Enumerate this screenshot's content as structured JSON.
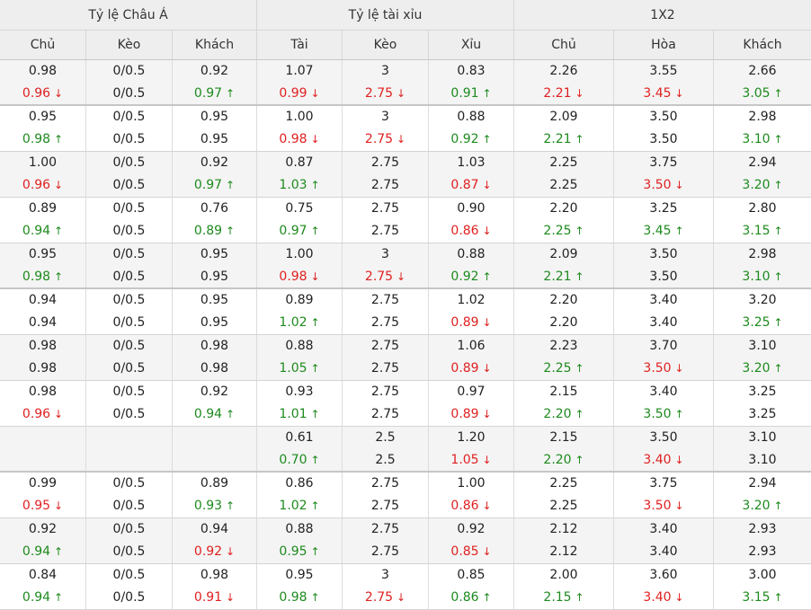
{
  "colors": {
    "up": "#1d8a1d",
    "down": "#e02020",
    "header_bg": "#eeeeee",
    "shade_bg": "#f4f4f4"
  },
  "header": {
    "groups": [
      "Tỷ lệ Châu Á",
      "Tỷ lệ tài xỉu",
      "1X2"
    ],
    "columns": [
      "Chủ",
      "Kèo",
      "Khách",
      "Tài",
      "Kèo",
      "Xỉu",
      "Chủ",
      "Hòa",
      "Khách"
    ]
  },
  "rows": [
    {
      "shade": true,
      "thick": true,
      "cells": [
        [
          [
            "0.98",
            ""
          ],
          [
            "0.96",
            "down"
          ]
        ],
        [
          [
            "0/0.5",
            ""
          ],
          [
            "0/0.5",
            ""
          ]
        ],
        [
          [
            "0.92",
            ""
          ],
          [
            "0.97",
            "up"
          ]
        ],
        [
          [
            "1.07",
            ""
          ],
          [
            "0.99",
            "down"
          ]
        ],
        [
          [
            "3",
            ""
          ],
          [
            "2.75",
            "down"
          ]
        ],
        [
          [
            "0.83",
            ""
          ],
          [
            "0.91",
            "up"
          ]
        ],
        [
          [
            "2.26",
            ""
          ],
          [
            "2.21",
            "down"
          ]
        ],
        [
          [
            "3.55",
            ""
          ],
          [
            "3.45",
            "down"
          ]
        ],
        [
          [
            "2.66",
            ""
          ],
          [
            "3.05",
            "up"
          ]
        ]
      ]
    },
    {
      "shade": false,
      "thick": false,
      "cells": [
        [
          [
            "0.95",
            ""
          ],
          [
            "0.98",
            "up"
          ]
        ],
        [
          [
            "0/0.5",
            ""
          ],
          [
            "0/0.5",
            ""
          ]
        ],
        [
          [
            "0.95",
            ""
          ],
          [
            "0.95",
            ""
          ]
        ],
        [
          [
            "1.00",
            ""
          ],
          [
            "0.98",
            "down"
          ]
        ],
        [
          [
            "3",
            ""
          ],
          [
            "2.75",
            "down"
          ]
        ],
        [
          [
            "0.88",
            ""
          ],
          [
            "0.92",
            "up"
          ]
        ],
        [
          [
            "2.09",
            ""
          ],
          [
            "2.21",
            "up"
          ]
        ],
        [
          [
            "3.50",
            ""
          ],
          [
            "3.50",
            ""
          ]
        ],
        [
          [
            "2.98",
            ""
          ],
          [
            "3.10",
            "up"
          ]
        ]
      ]
    },
    {
      "shade": true,
      "thick": false,
      "cells": [
        [
          [
            "1.00",
            ""
          ],
          [
            "0.96",
            "down"
          ]
        ],
        [
          [
            "0/0.5",
            ""
          ],
          [
            "0/0.5",
            ""
          ]
        ],
        [
          [
            "0.92",
            ""
          ],
          [
            "0.97",
            "up"
          ]
        ],
        [
          [
            "0.87",
            ""
          ],
          [
            "1.03",
            "up"
          ]
        ],
        [
          [
            "2.75",
            ""
          ],
          [
            "2.75",
            ""
          ]
        ],
        [
          [
            "1.03",
            ""
          ],
          [
            "0.87",
            "down"
          ]
        ],
        [
          [
            "2.25",
            ""
          ],
          [
            "2.25",
            ""
          ]
        ],
        [
          [
            "3.75",
            ""
          ],
          [
            "3.50",
            "down"
          ]
        ],
        [
          [
            "2.94",
            ""
          ],
          [
            "3.20",
            "up"
          ]
        ]
      ]
    },
    {
      "shade": false,
      "thick": false,
      "cells": [
        [
          [
            "0.89",
            ""
          ],
          [
            "0.94",
            "up"
          ]
        ],
        [
          [
            "0/0.5",
            ""
          ],
          [
            "0/0.5",
            ""
          ]
        ],
        [
          [
            "0.76",
            ""
          ],
          [
            "0.89",
            "up"
          ]
        ],
        [
          [
            "0.75",
            ""
          ],
          [
            "0.97",
            "up"
          ]
        ],
        [
          [
            "2.75",
            ""
          ],
          [
            "2.75",
            ""
          ]
        ],
        [
          [
            "0.90",
            ""
          ],
          [
            "0.86",
            "down"
          ]
        ],
        [
          [
            "2.20",
            ""
          ],
          [
            "2.25",
            "up"
          ]
        ],
        [
          [
            "3.25",
            ""
          ],
          [
            "3.45",
            "up"
          ]
        ],
        [
          [
            "2.80",
            ""
          ],
          [
            "3.15",
            "up"
          ]
        ]
      ]
    },
    {
      "shade": true,
      "thick": true,
      "cells": [
        [
          [
            "0.95",
            ""
          ],
          [
            "0.98",
            "up"
          ]
        ],
        [
          [
            "0/0.5",
            ""
          ],
          [
            "0/0.5",
            ""
          ]
        ],
        [
          [
            "0.95",
            ""
          ],
          [
            "0.95",
            ""
          ]
        ],
        [
          [
            "1.00",
            ""
          ],
          [
            "0.98",
            "down"
          ]
        ],
        [
          [
            "3",
            ""
          ],
          [
            "2.75",
            "down"
          ]
        ],
        [
          [
            "0.88",
            ""
          ],
          [
            "0.92",
            "up"
          ]
        ],
        [
          [
            "2.09",
            ""
          ],
          [
            "2.21",
            "up"
          ]
        ],
        [
          [
            "3.50",
            ""
          ],
          [
            "3.50",
            ""
          ]
        ],
        [
          [
            "2.98",
            ""
          ],
          [
            "3.10",
            "up"
          ]
        ]
      ]
    },
    {
      "shade": false,
      "thick": false,
      "cells": [
        [
          [
            "0.94",
            ""
          ],
          [
            "0.94",
            ""
          ]
        ],
        [
          [
            "0/0.5",
            ""
          ],
          [
            "0/0.5",
            ""
          ]
        ],
        [
          [
            "0.95",
            ""
          ],
          [
            "0.95",
            ""
          ]
        ],
        [
          [
            "0.89",
            ""
          ],
          [
            "1.02",
            "up"
          ]
        ],
        [
          [
            "2.75",
            ""
          ],
          [
            "2.75",
            ""
          ]
        ],
        [
          [
            "1.02",
            ""
          ],
          [
            "0.89",
            "down"
          ]
        ],
        [
          [
            "2.20",
            ""
          ],
          [
            "2.20",
            ""
          ]
        ],
        [
          [
            "3.40",
            ""
          ],
          [
            "3.40",
            ""
          ]
        ],
        [
          [
            "3.20",
            ""
          ],
          [
            "3.25",
            "up"
          ]
        ]
      ]
    },
    {
      "shade": true,
      "thick": false,
      "cells": [
        [
          [
            "0.98",
            ""
          ],
          [
            "0.98",
            ""
          ]
        ],
        [
          [
            "0/0.5",
            ""
          ],
          [
            "0/0.5",
            ""
          ]
        ],
        [
          [
            "0.98",
            ""
          ],
          [
            "0.98",
            ""
          ]
        ],
        [
          [
            "0.88",
            ""
          ],
          [
            "1.05",
            "up"
          ]
        ],
        [
          [
            "2.75",
            ""
          ],
          [
            "2.75",
            ""
          ]
        ],
        [
          [
            "1.06",
            ""
          ],
          [
            "0.89",
            "down"
          ]
        ],
        [
          [
            "2.23",
            ""
          ],
          [
            "2.25",
            "up"
          ]
        ],
        [
          [
            "3.70",
            ""
          ],
          [
            "3.50",
            "down"
          ]
        ],
        [
          [
            "3.10",
            ""
          ],
          [
            "3.20",
            "up"
          ]
        ]
      ]
    },
    {
      "shade": false,
      "thick": false,
      "cells": [
        [
          [
            "0.98",
            ""
          ],
          [
            "0.96",
            "down"
          ]
        ],
        [
          [
            "0/0.5",
            ""
          ],
          [
            "0/0.5",
            ""
          ]
        ],
        [
          [
            "0.92",
            ""
          ],
          [
            "0.94",
            "up"
          ]
        ],
        [
          [
            "0.93",
            ""
          ],
          [
            "1.01",
            "up"
          ]
        ],
        [
          [
            "2.75",
            ""
          ],
          [
            "2.75",
            ""
          ]
        ],
        [
          [
            "0.97",
            ""
          ],
          [
            "0.89",
            "down"
          ]
        ],
        [
          [
            "2.15",
            ""
          ],
          [
            "2.20",
            "up"
          ]
        ],
        [
          [
            "3.40",
            ""
          ],
          [
            "3.50",
            "up"
          ]
        ],
        [
          [
            "3.25",
            ""
          ],
          [
            "3.25",
            ""
          ]
        ]
      ]
    },
    {
      "shade": true,
      "thick": true,
      "cells": [
        [],
        [],
        [],
        [
          [
            "0.61",
            ""
          ],
          [
            "0.70",
            "up"
          ]
        ],
        [
          [
            "2.5",
            ""
          ],
          [
            "2.5",
            ""
          ]
        ],
        [
          [
            "1.20",
            ""
          ],
          [
            "1.05",
            "down"
          ]
        ],
        [
          [
            "2.15",
            ""
          ],
          [
            "2.20",
            "up"
          ]
        ],
        [
          [
            "3.50",
            ""
          ],
          [
            "3.40",
            "down"
          ]
        ],
        [
          [
            "3.10",
            ""
          ],
          [
            "3.10",
            ""
          ]
        ]
      ]
    },
    {
      "shade": false,
      "thick": false,
      "cells": [
        [
          [
            "0.99",
            ""
          ],
          [
            "0.95",
            "down"
          ]
        ],
        [
          [
            "0/0.5",
            ""
          ],
          [
            "0/0.5",
            ""
          ]
        ],
        [
          [
            "0.89",
            ""
          ],
          [
            "0.93",
            "up"
          ]
        ],
        [
          [
            "0.86",
            ""
          ],
          [
            "1.02",
            "up"
          ]
        ],
        [
          [
            "2.75",
            ""
          ],
          [
            "2.75",
            ""
          ]
        ],
        [
          [
            "1.00",
            ""
          ],
          [
            "0.86",
            "down"
          ]
        ],
        [
          [
            "2.25",
            ""
          ],
          [
            "2.25",
            ""
          ]
        ],
        [
          [
            "3.75",
            ""
          ],
          [
            "3.50",
            "down"
          ]
        ],
        [
          [
            "2.94",
            ""
          ],
          [
            "3.20",
            "up"
          ]
        ]
      ]
    },
    {
      "shade": true,
      "thick": false,
      "cells": [
        [
          [
            "0.92",
            ""
          ],
          [
            "0.94",
            "up"
          ]
        ],
        [
          [
            "0/0.5",
            ""
          ],
          [
            "0/0.5",
            ""
          ]
        ],
        [
          [
            "0.94",
            ""
          ],
          [
            "0.92",
            "down"
          ]
        ],
        [
          [
            "0.88",
            ""
          ],
          [
            "0.95",
            "up"
          ]
        ],
        [
          [
            "2.75",
            ""
          ],
          [
            "2.75",
            ""
          ]
        ],
        [
          [
            "0.92",
            ""
          ],
          [
            "0.85",
            "down"
          ]
        ],
        [
          [
            "2.12",
            ""
          ],
          [
            "2.12",
            ""
          ]
        ],
        [
          [
            "3.40",
            ""
          ],
          [
            "3.40",
            ""
          ]
        ],
        [
          [
            "2.93",
            ""
          ],
          [
            "2.93",
            ""
          ]
        ]
      ]
    },
    {
      "shade": false,
      "thick": false,
      "cells": [
        [
          [
            "0.84",
            ""
          ],
          [
            "0.94",
            "up"
          ]
        ],
        [
          [
            "0/0.5",
            ""
          ],
          [
            "0/0.5",
            ""
          ]
        ],
        [
          [
            "0.98",
            ""
          ],
          [
            "0.91",
            "down"
          ]
        ],
        [
          [
            "0.95",
            ""
          ],
          [
            "0.98",
            "up"
          ]
        ],
        [
          [
            "3",
            ""
          ],
          [
            "2.75",
            "down"
          ]
        ],
        [
          [
            "0.85",
            ""
          ],
          [
            "0.86",
            "up"
          ]
        ],
        [
          [
            "2.00",
            ""
          ],
          [
            "2.15",
            "up"
          ]
        ],
        [
          [
            "3.60",
            ""
          ],
          [
            "3.40",
            "down"
          ]
        ],
        [
          [
            "3.00",
            ""
          ],
          [
            "3.15",
            "up"
          ]
        ]
      ]
    }
  ]
}
